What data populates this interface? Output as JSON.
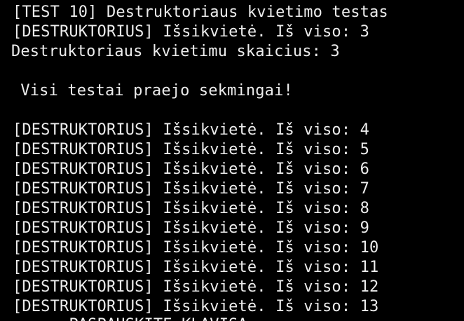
{
  "terminal": {
    "background": "#000000",
    "foreground": "#ececec",
    "lines": [
      "[TEST 10] Destruktoriaus kvietimo testas",
      "[DESTRUKTORIUS] Išsikvietė. Iš viso: 3",
      "Destruktoriaus kvietimu skaicius: 3",
      "",
      " Visi testai praejo sekmingai!",
      "",
      "[DESTRUKTORIUS] Išsikvietė. Iš viso: 4",
      "[DESTRUKTORIUS] Išsikvietė. Iš viso: 5",
      "[DESTRUKTORIUS] Išsikvietė. Iš viso: 6",
      "[DESTRUKTORIUS] Išsikvietė. Iš viso: 7",
      "[DESTRUKTORIUS] Išsikvietė. Iš viso: 8",
      "[DESTRUKTORIUS] Išsikvietė. Iš viso: 9",
      "[DESTRUKTORIUS] Išsikvietė. Iš viso: 10",
      "[DESTRUKTORIUS] Išsikvietė. Iš viso: 11",
      "[DESTRUKTORIUS] Išsikvietė. Iš viso: 12",
      "[DESTRUKTORIUS] Išsikvietė. Iš viso: 13",
      "      PASPAUSKITE KLAVISA"
    ]
  }
}
